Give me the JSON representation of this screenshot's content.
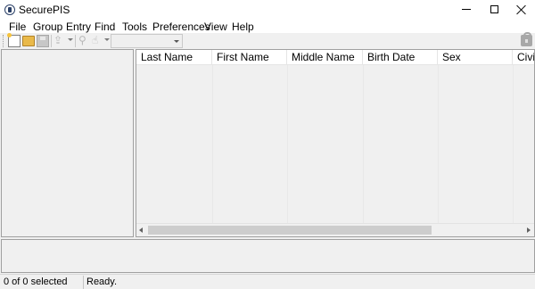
{
  "window": {
    "title": "SecurePIS",
    "icon": "lock-shield-icon"
  },
  "menu": {
    "items": [
      "File",
      "Group",
      "Entry",
      "Find",
      "Tools",
      "Preferences",
      "View",
      "Help"
    ]
  },
  "toolbar": {
    "icons": [
      "new-document-icon",
      "open-folder-icon",
      "save-icon",
      "share-icon",
      "search-icon",
      "find-next-icon",
      "lock-icon"
    ],
    "combo_value": ""
  },
  "grid": {
    "columns": [
      "Last Name",
      "First Name",
      "Middle Name",
      "Birth Date",
      "Sex",
      "Civil S"
    ],
    "rows": []
  },
  "status": {
    "selection": "0 of 0 selected",
    "message": "Ready."
  }
}
